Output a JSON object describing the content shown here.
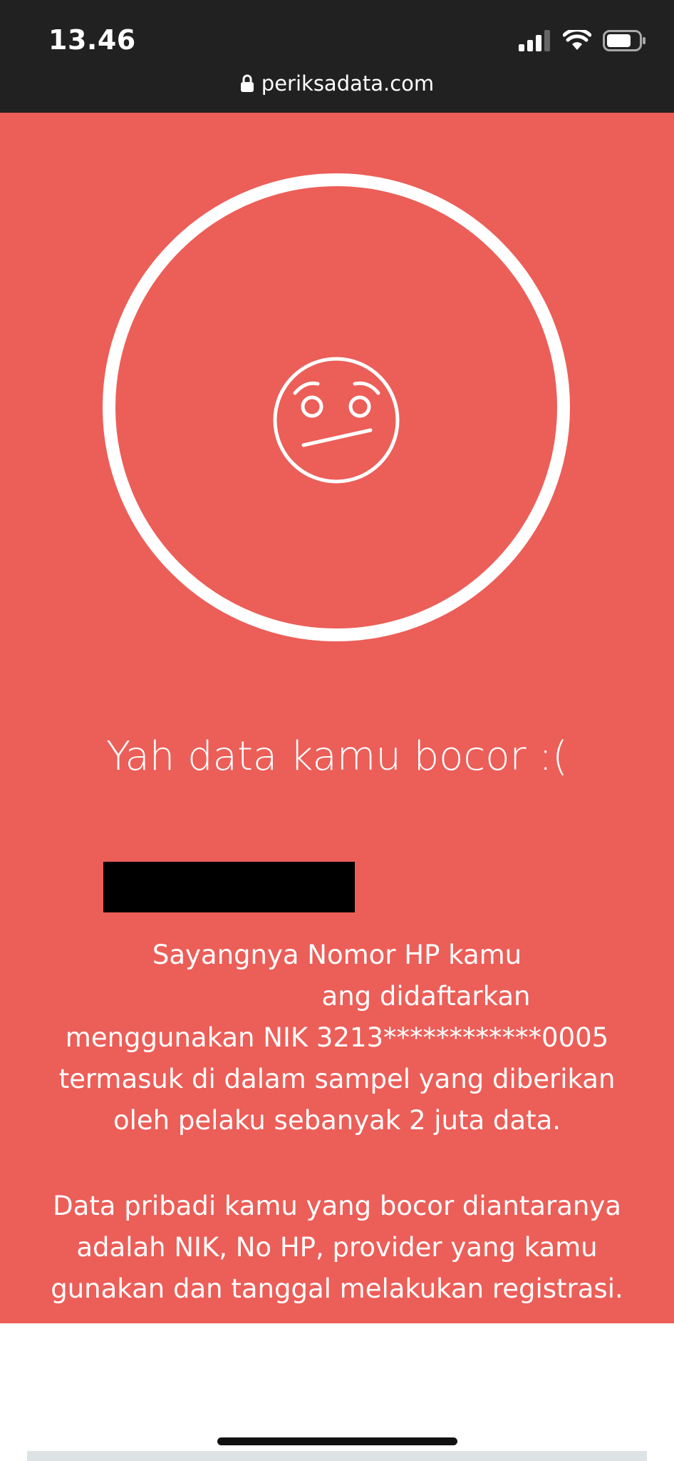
{
  "status_bar": {
    "time": "13.46",
    "icons": [
      "signal-icon",
      "wifi-icon",
      "battery-icon"
    ]
  },
  "browser": {
    "url": "periksadata.com",
    "lock_icon": "lock-icon"
  },
  "result": {
    "icon": "worried-face-icon",
    "title": "Yah data kamu bocor :(",
    "paragraph_1_lines": [
      "Sayangnya Nomor HP kamu",
      "ang didaftarkan",
      "menggunakan NIK 3213************0005",
      "termasuk di dalam sampel yang diberikan",
      "oleh pelaku sebanyak 2 juta data."
    ],
    "paragraph_2_lines": [
      "Data pribadi kamu yang bocor diantaranya",
      "adalah NIK, No HP, provider yang kamu",
      "gunakan dan tanggal melakukan registrasi."
    ]
  },
  "colors": {
    "hero_background": "#ec5e58",
    "status_bar_background": "#212121",
    "text": "#ffffff",
    "redaction": "#000000"
  }
}
